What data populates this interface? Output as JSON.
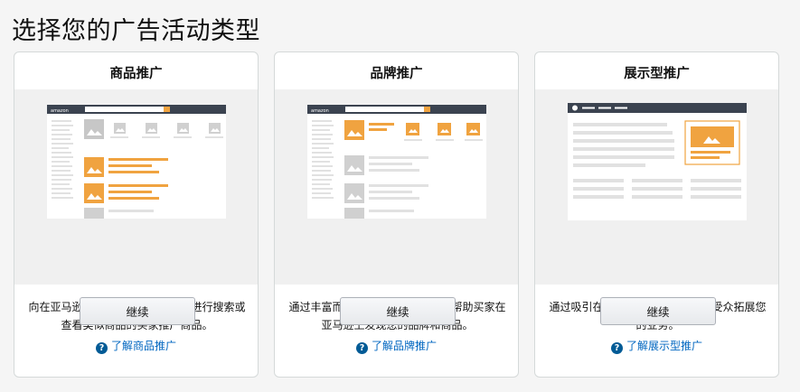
{
  "page": {
    "title": "选择您的广告活动类型"
  },
  "cards": [
    {
      "title": "商品推广",
      "description": "向在亚马逊上积极使用相关关键词进行搜索或查看类似商品的买家推广商品。",
      "button_label": "继续",
      "learn_more": "了解商品推广",
      "mock_logo": "amazon"
    },
    {
      "title": "品牌推广",
      "description": "通过丰富而富有吸引力的广告素材帮助买家在亚马逊上发现您的品牌和商品。",
      "button_label": "继续",
      "learn_more": "了解品牌推广",
      "mock_logo": "amazon"
    },
    {
      "title": "展示型推广",
      "description": "通过吸引在亚马逊网站内外的相关受众拓展您的业务。",
      "button_label": "继续",
      "learn_more": "了解展示型推广"
    }
  ],
  "colors": {
    "accent": "#f0a340",
    "card_border": "#d5d9d9",
    "link": "#0066c0",
    "help_icon": "#005b96",
    "mock_header": "#3b4350"
  },
  "icons": {
    "help": "help-icon",
    "image_placeholder": "image-icon"
  }
}
